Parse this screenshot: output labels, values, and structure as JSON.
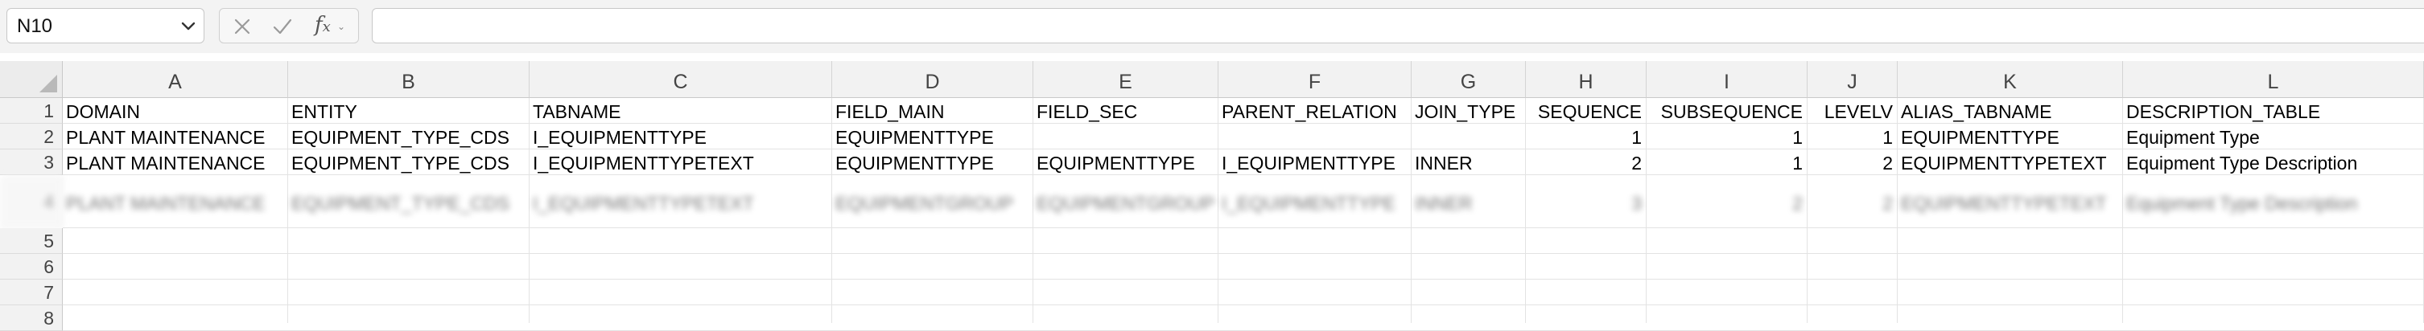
{
  "name_box": {
    "value": "N10"
  },
  "formula": {
    "value": ""
  },
  "icons": {
    "cancel": "close-icon",
    "enter": "check-icon",
    "function": "fx-icon",
    "dropdown": "chevron-down-icon"
  },
  "colors": {
    "toolbar_bg": "#f3f3f3",
    "header_bg": "#f2f2f2",
    "grid_line": "#e3e3e3"
  },
  "sheet": {
    "columns": [
      "A",
      "B",
      "C",
      "D",
      "E",
      "F",
      "G",
      "H",
      "I",
      "J",
      "K",
      "L"
    ],
    "row_numbers": [
      "1",
      "2",
      "3",
      "4",
      "5",
      "6",
      "7",
      "8"
    ],
    "rows": [
      [
        "DOMAIN",
        "ENTITY",
        "TABNAME",
        "FIELD_MAIN",
        "FIELD_SEC",
        "PARENT_RELATION",
        "JOIN_TYPE",
        "SEQUENCE",
        "SUBSEQUENCE",
        "LEVELV",
        "ALIAS_TABNAME",
        "DESCRIPTION_TABLE"
      ],
      [
        "PLANT MAINTENANCE",
        "EQUIPMENT_TYPE_CDS",
        "I_EQUIPMENTTYPE",
        "EQUIPMENTTYPE",
        "",
        "",
        "",
        "1",
        "1",
        "1",
        "EQUIPMENTTYPE",
        "Equipment Type"
      ],
      [
        "PLANT MAINTENANCE",
        "EQUIPMENT_TYPE_CDS",
        "I_EQUIPMENTTYPETEXT",
        "EQUIPMENTTYPE",
        "EQUIPMENTTYPE",
        "I_EQUIPMENTTYPE",
        "INNER",
        "2",
        "1",
        "2",
        "EQUIPMENTTYPETEXT",
        "Equipment Type Description"
      ],
      [
        "PLANT MAINTENANCE",
        "EQUIPMENT_TYPE_CDS",
        "I_EQUIPMENTTYPETEXT",
        "EQUIPMENTGROUP",
        "EQUIPMENTGROUP",
        "I_EQUIPMENTTYPE",
        "INNER",
        "3",
        "2",
        "2",
        "EQUIPMENTTYPETEXT",
        "Equipment Type Description"
      ]
    ]
  }
}
